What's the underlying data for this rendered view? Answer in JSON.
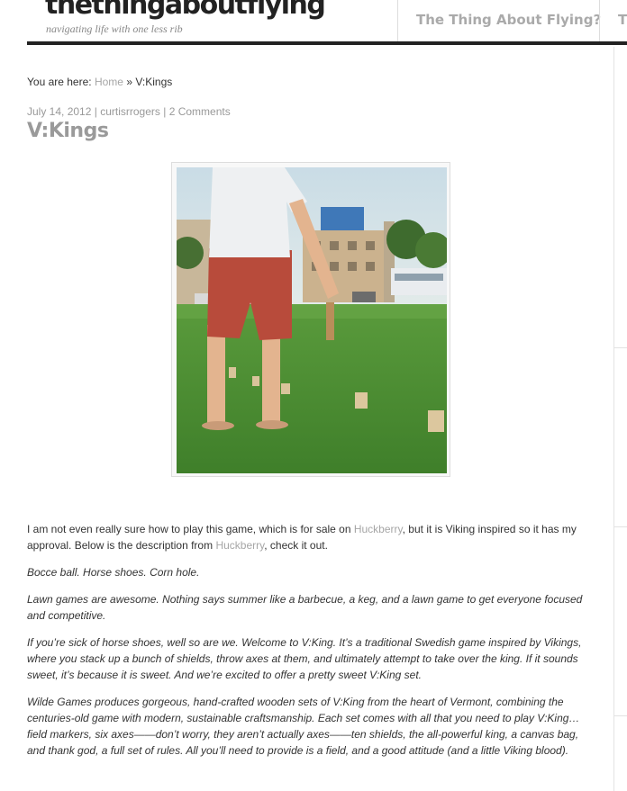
{
  "site": {
    "title": "thethingaboutflying",
    "tagline": "navigating life with one less rib"
  },
  "nav": {
    "items": [
      {
        "label": "The Thing About Flying?"
      },
      {
        "label": "T"
      }
    ]
  },
  "breadcrumb": {
    "prefix": "You are here:",
    "home": "Home",
    "separator": "»",
    "current": "V:Kings"
  },
  "post": {
    "date": "July 14, 2012",
    "separator": "|",
    "author": "curtisrrogers",
    "comments": "2 Comments",
    "title": "V:Kings",
    "photo_icon": "lawn-game-photo",
    "intro": {
      "text_before": "I am not even really sure how to play this game, which is for sale on ",
      "link1": "Huckberry",
      "text_middle": ", but it is Viking inspired so it has my approval. Below is the description from ",
      "link2": "Huckberry",
      "text_after": ", check it out."
    },
    "quotes": [
      "Bocce ball. Horse shoes. Corn hole.",
      "Lawn games are awesome. Nothing says summer like a barbecue, a keg, and a lawn game to get everyone focused and competitive.",
      "If you’re sick of horse shoes, well so are we. Welcome to V:King. It’s a traditional Swedish game inspired by Vikings, where you stack up a bunch of shields, throw axes at them, and ultimately attempt to take over the king. If it sounds sweet, it’s because it is sweet. And we’re excited to offer a pretty sweet V:King set.",
      "Wilde Games produces gorgeous, hand-crafted wooden sets of V:King from the heart of Vermont, combining the centuries-old game with modern, sustainable craftsmanship. Each set comes with all that you need to play V:King…field markers, six axes——don’t worry, they aren’t actually axes——ten shields, the all-powerful king, a canvas bag, and thank god, a full set of rules. All you’ll need to provide is a field, and a good attitude (and a little Viking blood)."
    ]
  },
  "colors": {
    "header_rule": "#222222",
    "link": "#a6a6a6",
    "nav": "#aaaaaa",
    "title": "#9a9a9a"
  }
}
